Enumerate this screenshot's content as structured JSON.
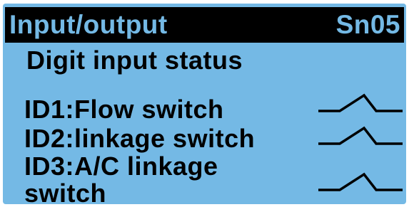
{
  "header": {
    "title": "Input/output",
    "code": "Sn05"
  },
  "subtitle": "Digit input status",
  "inputs": [
    {
      "label_lines": [
        "ID1:Flow switch"
      ],
      "state_icon": "switch-open-icon"
    },
    {
      "label_lines": [
        "ID2:linkage switch"
      ],
      "state_icon": "switch-open-icon"
    },
    {
      "label_lines": [
        "ID3:A/C linkage",
        "switch"
      ],
      "state_icon": "switch-open-icon"
    }
  ],
  "colors": {
    "screen_background": "#74b9e5",
    "header_background": "#000000",
    "text": "#000000"
  }
}
